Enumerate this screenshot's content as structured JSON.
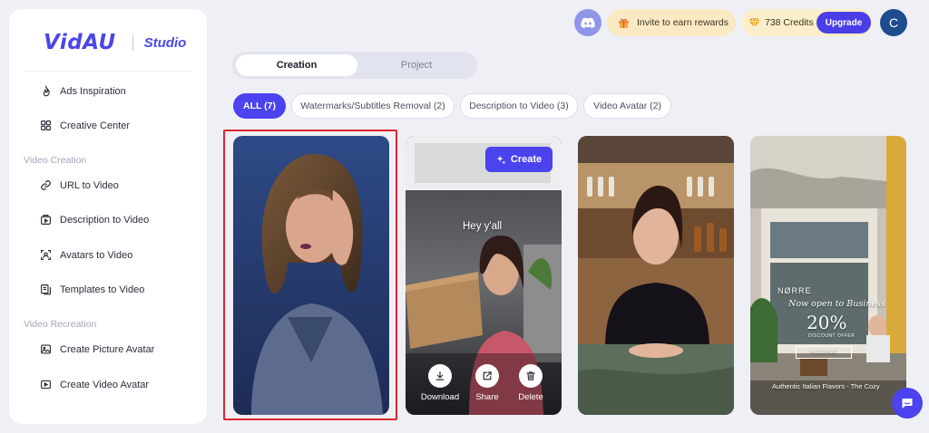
{
  "brand": {
    "logo": "VidAU",
    "product": "Studio"
  },
  "sidebar": {
    "items_top": [
      {
        "label": "Ads Inspiration",
        "icon": "flame-icon"
      },
      {
        "label": "Creative Center",
        "icon": "grid-icon"
      }
    ],
    "sections": [
      {
        "title": "Video Creation",
        "items": [
          {
            "label": "URL to Video",
            "icon": "link-icon"
          },
          {
            "label": "Description to Video",
            "icon": "doc-video-icon"
          },
          {
            "label": "Avatars to Video",
            "icon": "avatar-scan-icon"
          },
          {
            "label": "Templates to Video",
            "icon": "template-icon"
          }
        ]
      },
      {
        "title": "Video Recreation",
        "items": [
          {
            "label": "Create Picture Avatar",
            "icon": "picture-icon"
          },
          {
            "label": "Create Video Avatar",
            "icon": "video-icon"
          }
        ]
      }
    ]
  },
  "header": {
    "invite_label": "Invite to earn rewards",
    "credits_label": "738 Credits",
    "upgrade_label": "Upgrade",
    "avatar_initial": "C"
  },
  "tabs": [
    {
      "label": "Creation",
      "active": true
    },
    {
      "label": "Project",
      "active": false
    }
  ],
  "filters": [
    {
      "label": "ALL (7)",
      "active": true
    },
    {
      "label": "Watermarks/Subtitles Removal (2)",
      "active": false
    },
    {
      "label": "Description to Video (3)",
      "active": false
    },
    {
      "label": "Video Avatar (2)",
      "active": false
    }
  ],
  "cards": {
    "card2": {
      "create_label": "Create",
      "caption": "Hey y'all",
      "actions": [
        {
          "label": "Download",
          "icon": "download-icon"
        },
        {
          "label": "Share",
          "icon": "share-icon"
        },
        {
          "label": "Delete",
          "icon": "trash-icon"
        }
      ]
    },
    "card4": {
      "brand_text": "NØRRE",
      "headline": "Now open to Business",
      "percent": "20%",
      "discount_label": "DISCOUNT OFFER",
      "cta_label": "RESERVE",
      "footer": "Authentic Italian Flavors - The Cozy"
    }
  },
  "colors": {
    "accent": "#4b43ee",
    "selection": "#e0242f",
    "credits_bg": "#fbeecb"
  }
}
